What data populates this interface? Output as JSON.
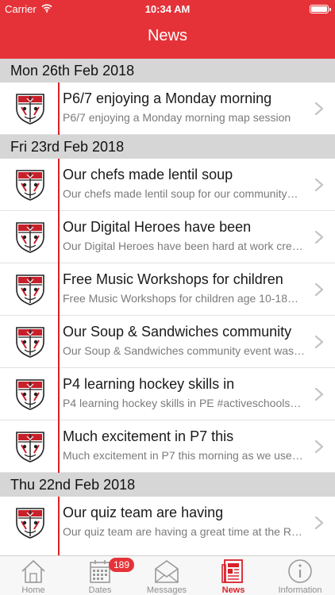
{
  "status_bar": {
    "carrier": "Carrier",
    "time": "10:34 AM"
  },
  "nav": {
    "title": "News"
  },
  "colors": {
    "accent": "#e53238",
    "timeline": "#d9202a",
    "section_bg": "#d6d6d6"
  },
  "sections": [
    {
      "date": "Mon 26th Feb 2018",
      "items": [
        {
          "title": "P6/7 enjoying a Monday morning",
          "subtitle": "P6/7 enjoying a Monday morning map session"
        }
      ]
    },
    {
      "date": "Fri 23rd Feb 2018",
      "items": [
        {
          "title": "Our chefs made lentil soup",
          "subtitle": "Our chefs made lentil soup for our community…"
        },
        {
          "title": "Our Digital Heroes have been",
          "subtitle": "Our Digital Heroes have been hard at work cre…"
        },
        {
          "title": "Free Music Workshops for children",
          "subtitle": "Free Music Workshops for children age 10-18…"
        },
        {
          "title": "Our Soup & Sandwiches community",
          "subtitle": "Our Soup & Sandwiches community event was…"
        },
        {
          "title": "P4 learning hockey skills in",
          "subtitle": "P4 learning hockey skills in PE #activeschools…"
        },
        {
          "title": "Much excitement in P7 this",
          "subtitle": "Much excitement in P7 this morning as we use…"
        }
      ]
    },
    {
      "date": "Thu 22nd Feb 2018",
      "items": [
        {
          "title": "Our quiz team are having",
          "subtitle": "Our quiz team are having a great time at the R…"
        }
      ]
    }
  ],
  "tabbar": {
    "tabs": [
      {
        "label": "Home",
        "icon": "home-icon"
      },
      {
        "label": "Dates",
        "icon": "calendar-icon"
      },
      {
        "label": "Messages",
        "icon": "envelope-icon",
        "badge": "189"
      },
      {
        "label": "News",
        "icon": "newspaper-icon",
        "active": true
      },
      {
        "label": "Information",
        "icon": "info-icon"
      }
    ]
  }
}
